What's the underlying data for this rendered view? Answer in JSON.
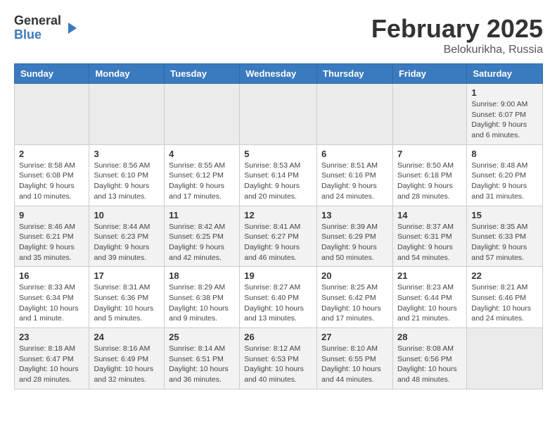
{
  "logo": {
    "general": "General",
    "blue": "Blue"
  },
  "title": "February 2025",
  "subtitle": "Belokurikha, Russia",
  "days_of_week": [
    "Sunday",
    "Monday",
    "Tuesday",
    "Wednesday",
    "Thursday",
    "Friday",
    "Saturday"
  ],
  "weeks": [
    [
      {
        "day": "",
        "info": ""
      },
      {
        "day": "",
        "info": ""
      },
      {
        "day": "",
        "info": ""
      },
      {
        "day": "",
        "info": ""
      },
      {
        "day": "",
        "info": ""
      },
      {
        "day": "",
        "info": ""
      },
      {
        "day": "1",
        "info": "Sunrise: 9:00 AM\nSunset: 6:07 PM\nDaylight: 9 hours and 6 minutes."
      }
    ],
    [
      {
        "day": "2",
        "info": "Sunrise: 8:58 AM\nSunset: 6:08 PM\nDaylight: 9 hours and 10 minutes."
      },
      {
        "day": "3",
        "info": "Sunrise: 8:56 AM\nSunset: 6:10 PM\nDaylight: 9 hours and 13 minutes."
      },
      {
        "day": "4",
        "info": "Sunrise: 8:55 AM\nSunset: 6:12 PM\nDaylight: 9 hours and 17 minutes."
      },
      {
        "day": "5",
        "info": "Sunrise: 8:53 AM\nSunset: 6:14 PM\nDaylight: 9 hours and 20 minutes."
      },
      {
        "day": "6",
        "info": "Sunrise: 8:51 AM\nSunset: 6:16 PM\nDaylight: 9 hours and 24 minutes."
      },
      {
        "day": "7",
        "info": "Sunrise: 8:50 AM\nSunset: 6:18 PM\nDaylight: 9 hours and 28 minutes."
      },
      {
        "day": "8",
        "info": "Sunrise: 8:48 AM\nSunset: 6:20 PM\nDaylight: 9 hours and 31 minutes."
      }
    ],
    [
      {
        "day": "9",
        "info": "Sunrise: 8:46 AM\nSunset: 6:21 PM\nDaylight: 9 hours and 35 minutes."
      },
      {
        "day": "10",
        "info": "Sunrise: 8:44 AM\nSunset: 6:23 PM\nDaylight: 9 hours and 39 minutes."
      },
      {
        "day": "11",
        "info": "Sunrise: 8:42 AM\nSunset: 6:25 PM\nDaylight: 9 hours and 42 minutes."
      },
      {
        "day": "12",
        "info": "Sunrise: 8:41 AM\nSunset: 6:27 PM\nDaylight: 9 hours and 46 minutes."
      },
      {
        "day": "13",
        "info": "Sunrise: 8:39 AM\nSunset: 6:29 PM\nDaylight: 9 hours and 50 minutes."
      },
      {
        "day": "14",
        "info": "Sunrise: 8:37 AM\nSunset: 6:31 PM\nDaylight: 9 hours and 54 minutes."
      },
      {
        "day": "15",
        "info": "Sunrise: 8:35 AM\nSunset: 6:33 PM\nDaylight: 9 hours and 57 minutes."
      }
    ],
    [
      {
        "day": "16",
        "info": "Sunrise: 8:33 AM\nSunset: 6:34 PM\nDaylight: 10 hours and 1 minute."
      },
      {
        "day": "17",
        "info": "Sunrise: 8:31 AM\nSunset: 6:36 PM\nDaylight: 10 hours and 5 minutes."
      },
      {
        "day": "18",
        "info": "Sunrise: 8:29 AM\nSunset: 6:38 PM\nDaylight: 10 hours and 9 minutes."
      },
      {
        "day": "19",
        "info": "Sunrise: 8:27 AM\nSunset: 6:40 PM\nDaylight: 10 hours and 13 minutes."
      },
      {
        "day": "20",
        "info": "Sunrise: 8:25 AM\nSunset: 6:42 PM\nDaylight: 10 hours and 17 minutes."
      },
      {
        "day": "21",
        "info": "Sunrise: 8:23 AM\nSunset: 6:44 PM\nDaylight: 10 hours and 21 minutes."
      },
      {
        "day": "22",
        "info": "Sunrise: 8:21 AM\nSunset: 6:46 PM\nDaylight: 10 hours and 24 minutes."
      }
    ],
    [
      {
        "day": "23",
        "info": "Sunrise: 8:18 AM\nSunset: 6:47 PM\nDaylight: 10 hours and 28 minutes."
      },
      {
        "day": "24",
        "info": "Sunrise: 8:16 AM\nSunset: 6:49 PM\nDaylight: 10 hours and 32 minutes."
      },
      {
        "day": "25",
        "info": "Sunrise: 8:14 AM\nSunset: 6:51 PM\nDaylight: 10 hours and 36 minutes."
      },
      {
        "day": "26",
        "info": "Sunrise: 8:12 AM\nSunset: 6:53 PM\nDaylight: 10 hours and 40 minutes."
      },
      {
        "day": "27",
        "info": "Sunrise: 8:10 AM\nSunset: 6:55 PM\nDaylight: 10 hours and 44 minutes."
      },
      {
        "day": "28",
        "info": "Sunrise: 8:08 AM\nSunset: 6:56 PM\nDaylight: 10 hours and 48 minutes."
      },
      {
        "day": "",
        "info": ""
      }
    ]
  ]
}
